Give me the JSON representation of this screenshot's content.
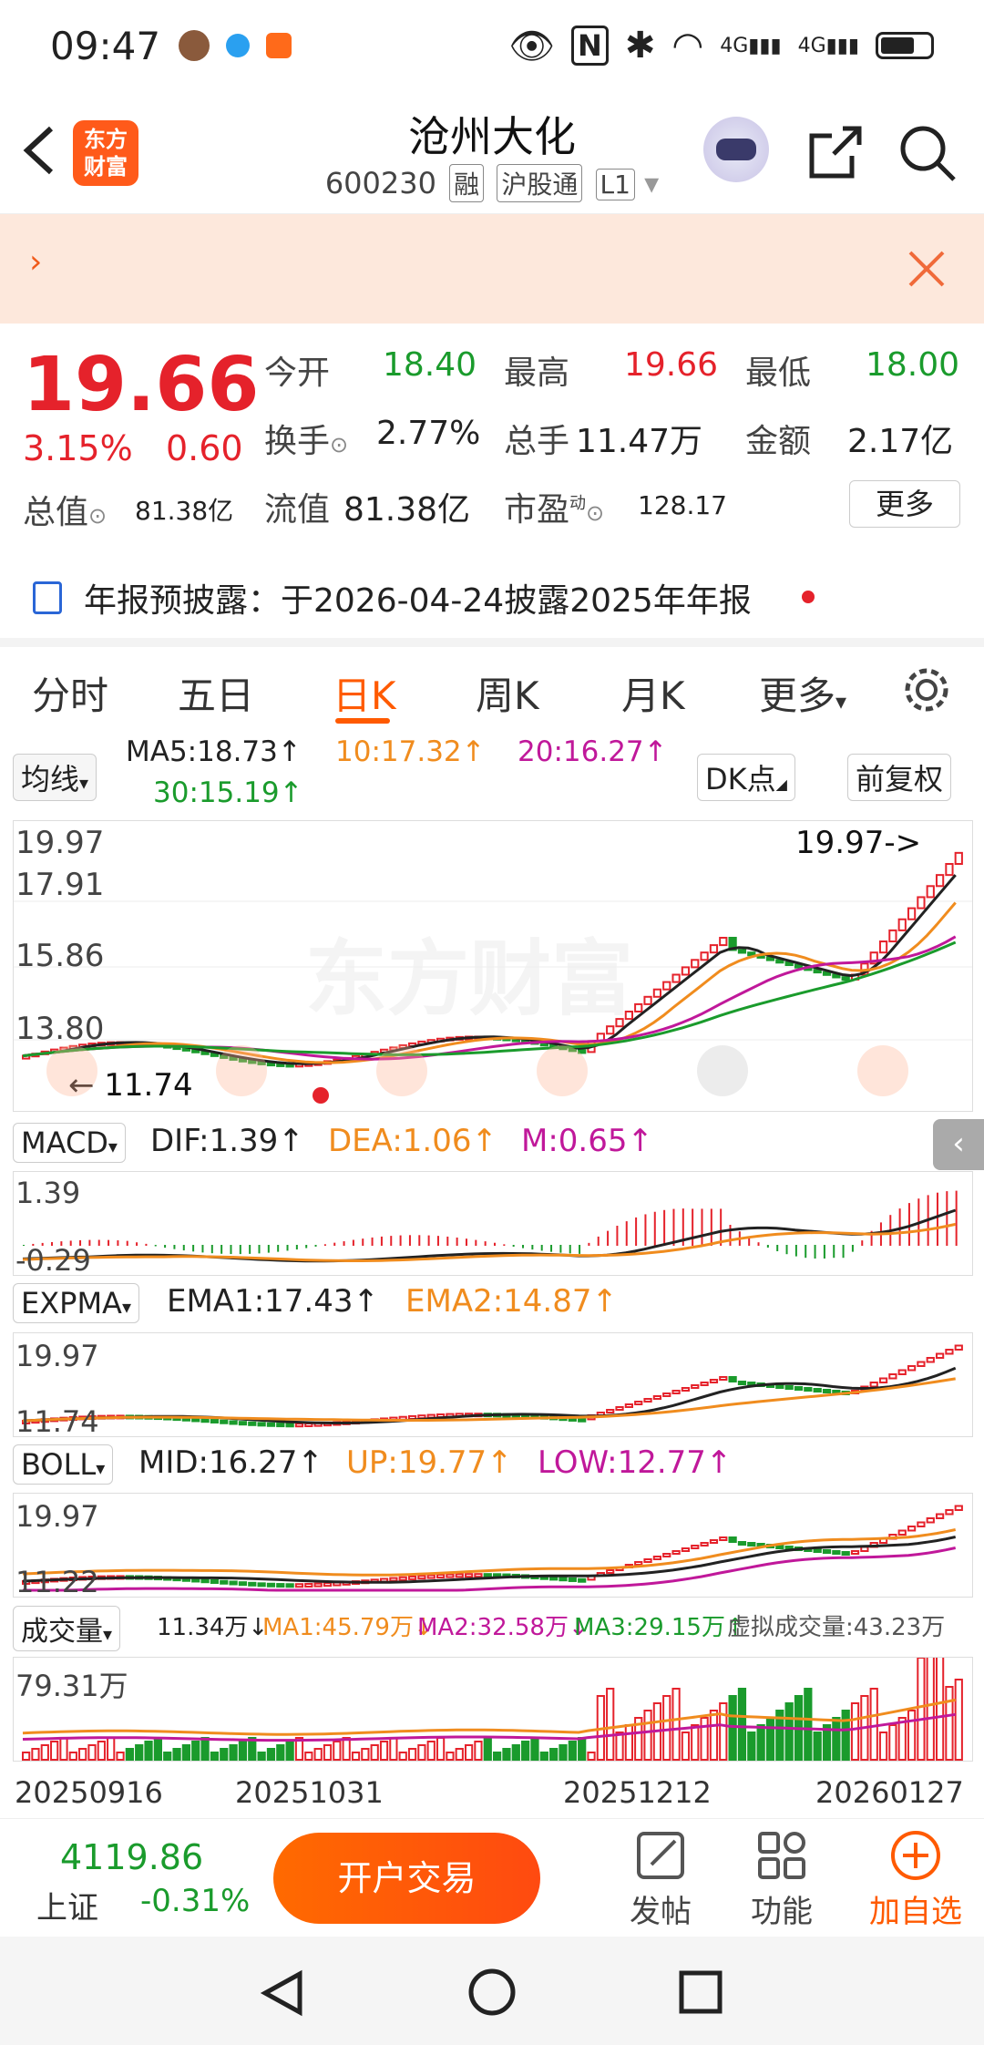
{
  "status": {
    "time": "09:47",
    "net1": "4G",
    "net2": "4G"
  },
  "header": {
    "title": "沧州大化",
    "code": "600230",
    "tag_rong": "融",
    "tag_hgt": "沪股通",
    "tag_level": "L1",
    "logo_line1": "东方",
    "logo_line2": "财富"
  },
  "notice": {
    "arrow": "›"
  },
  "quote": {
    "price": "19.66",
    "pct": "3.15%",
    "chg": "0.60",
    "open_label": "今开",
    "open": "18.40",
    "high_label": "最高",
    "high": "19.66",
    "low_label": "最低",
    "low": "18.00",
    "turnover_label": "换手",
    "turnover": "2.77%",
    "vol_label": "总手",
    "vol": "11.47万",
    "amount_label": "金额",
    "amount": "2.17亿",
    "mktcap_label": "总值",
    "mktcap": "81.38亿",
    "float_label": "流值",
    "float": "81.38亿",
    "pe_label": "市盈",
    "pe_sup": "动",
    "pe": "128.17",
    "more": "更多",
    "announce": "年报预披露：于2026-04-24披露2025年年报"
  },
  "tabs": [
    "分时",
    "五日",
    "日K",
    "周K",
    "月K",
    "更多"
  ],
  "ma": {
    "sel": "均线",
    "ma5": "MA5:18.73↑",
    "ma10": "10:17.32↑",
    "ma20": "20:16.27↑",
    "ma30": "30:15.19↑",
    "dk": "DK点",
    "fq": "前复权"
  },
  "kline": {
    "y1": "19.97",
    "y2": "17.91",
    "y3": "15.86",
    "y4": "13.80",
    "low_mark": "11.74",
    "high_mark": "19.97->",
    "watermark": "东方财富"
  },
  "macd": {
    "sel": "MACD",
    "dif": "DIF:1.39↑",
    "dea": "DEA:1.06↑",
    "m": "M:0.65↑",
    "y1": "1.39",
    "y2": "-0.29"
  },
  "expma": {
    "sel": "EXPMA",
    "ema1": "EMA1:17.43↑",
    "ema2": "EMA2:14.87↑",
    "y1": "19.97",
    "y2": "11.74"
  },
  "boll": {
    "sel": "BOLL",
    "mid": "MID:16.27↑",
    "up": "UP:19.77↑",
    "low": "LOW:12.77↑",
    "y1": "19.97",
    "y2": "11.22"
  },
  "volume": {
    "sel": "成交量",
    "v": "11.34万↓",
    "ma1": "MA1:45.79万↓",
    "ma2": "MA2:32.58万↓",
    "ma3": "MA3:29.15万↑",
    "virtual": "虚拟成交量:43.23万",
    "y1": "79.31万"
  },
  "dates": [
    "20250916",
    "20251031",
    "20251212",
    "20260127"
  ],
  "bottom": {
    "index_val": "4119.86",
    "index_name": "上证",
    "index_pct": "-0.31%",
    "trade": "开户交易",
    "post": "发帖",
    "func": "功能",
    "watch": "加自选"
  },
  "colors": {
    "up": "#e5222b",
    "down": "#1a9b2c",
    "accent": "#ff5a00",
    "ma10": "#f08c1e",
    "ma20": "#c0189a"
  }
}
